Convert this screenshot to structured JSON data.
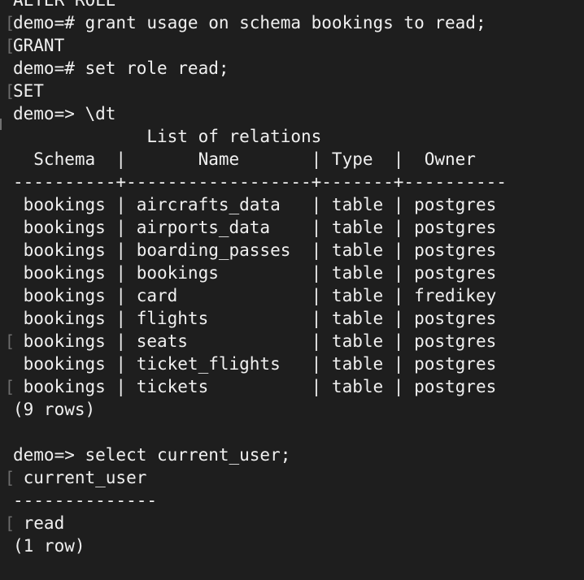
{
  "terminal": {
    "lines": [
      {
        "text": "ALTER ROLE",
        "mark": false
      },
      {
        "text": "demo=# grant usage on schema bookings to read;",
        "mark": true
      },
      {
        "text": "GRANT",
        "mark": true
      },
      {
        "text": "demo=# set role read;",
        "mark": false
      },
      {
        "text": "SET",
        "mark": true
      },
      {
        "text": "demo=> \\dt",
        "mark": false
      },
      {
        "text": "             List of relations",
        "mark": false
      },
      {
        "text": "  Schema  |       Name       | Type  |  Owner",
        "mark": false
      },
      {
        "text": "----------+------------------+-------+----------",
        "mark": false
      },
      {
        "text": " bookings | aircrafts_data   | table | postgres",
        "mark": false
      },
      {
        "text": " bookings | airports_data    | table | postgres",
        "mark": false
      },
      {
        "text": " bookings | boarding_passes  | table | postgres",
        "mark": false
      },
      {
        "text": " bookings | bookings         | table | postgres",
        "mark": false
      },
      {
        "text": " bookings | card             | table | fredikey",
        "mark": false
      },
      {
        "text": " bookings | flights          | table | postgres",
        "mark": false
      },
      {
        "text": " bookings | seats            | table | postgres",
        "mark": true
      },
      {
        "text": " bookings | ticket_flights   | table | postgres",
        "mark": false
      },
      {
        "text": " bookings | tickets          | table | postgres",
        "mark": true
      },
      {
        "text": "(9 rows)",
        "mark": false
      },
      {
        "text": "",
        "mark": false
      },
      {
        "text": "demo=> select current_user;",
        "mark": false
      },
      {
        "text": " current_user",
        "mark": true
      },
      {
        "text": "--------------",
        "mark": false
      },
      {
        "text": " read",
        "mark": true
      },
      {
        "text": "(1 row)",
        "mark": false
      },
      {
        "text": "",
        "mark": false
      }
    ]
  }
}
